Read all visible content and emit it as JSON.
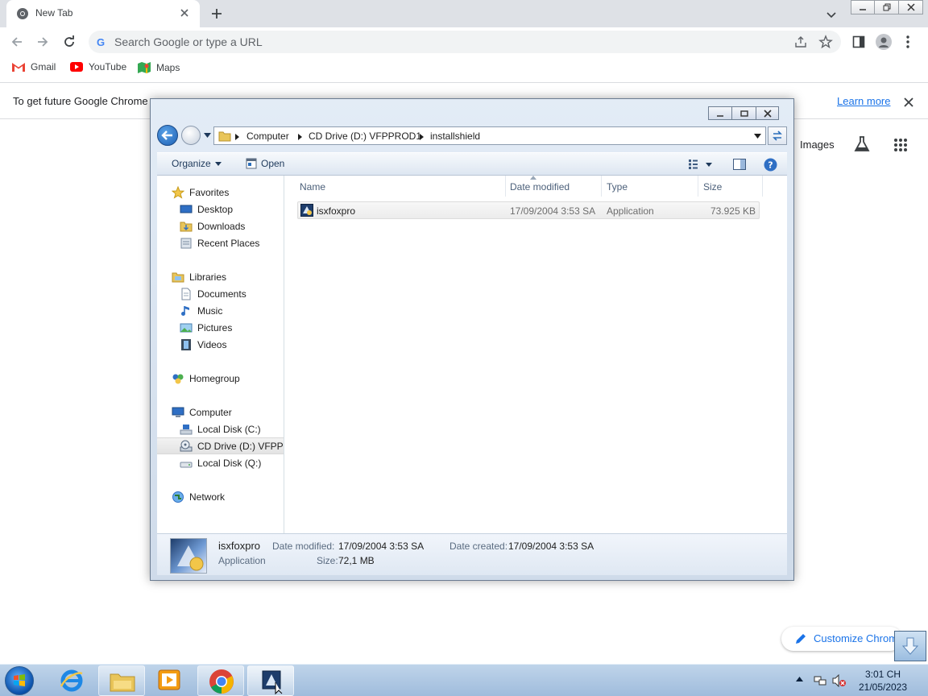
{
  "browser": {
    "tab_title": "New Tab",
    "omnibox_placeholder": "Search Google or type a URL",
    "bookmarks": [
      {
        "label": "Gmail",
        "icon": "gmail-icon"
      },
      {
        "label": "YouTube",
        "icon": "youtube-icon"
      },
      {
        "label": "Maps",
        "icon": "maps-icon"
      }
    ],
    "infobar_text": "To get future Google Chrome",
    "infobar_link": "Learn more",
    "ntp_images_link": "Images",
    "customize_label": "Customize Chrome"
  },
  "explorer": {
    "breadcrumbs": [
      "Computer",
      "CD Drive (D:) VFPPROD1",
      "installshield"
    ],
    "commands": {
      "organize": "Organize",
      "open": "Open"
    },
    "nav": {
      "favorites": "Favorites",
      "desktop": "Desktop",
      "downloads": "Downloads",
      "recent": "Recent Places",
      "libraries": "Libraries",
      "documents": "Documents",
      "music": "Music",
      "pictures": "Pictures",
      "videos": "Videos",
      "homegroup": "Homegroup",
      "computer": "Computer",
      "local_c": "Local Disk (C:)",
      "cd_drive": "CD Drive (D:) VFPPR",
      "local_q": "Local Disk (Q:)",
      "network": "Network"
    },
    "columns": {
      "name": "Name",
      "date": "Date modified",
      "type": "Type",
      "size": "Size"
    },
    "file": {
      "name": "isxfoxpro",
      "date": "17/09/2004 3:53 SA",
      "type": "Application",
      "size": "73.925 KB"
    },
    "details": {
      "name": "isxfoxpro",
      "type": "Application",
      "modified_label": "Date modified:",
      "modified": "17/09/2004 3:53 SA",
      "created_label": "Date created:",
      "created": "17/09/2004 3:53 SA",
      "size_label": "Size:",
      "size": "72,1 MB"
    }
  },
  "taskbar": {
    "time": "3:01 CH",
    "date": "21/05/2023"
  },
  "colors": {
    "chrome_tabstrip": "#dee1e6",
    "link_blue": "#1a73e8",
    "explorer_frame": "#cfdbea",
    "taskbar": "#a9c4e2"
  }
}
